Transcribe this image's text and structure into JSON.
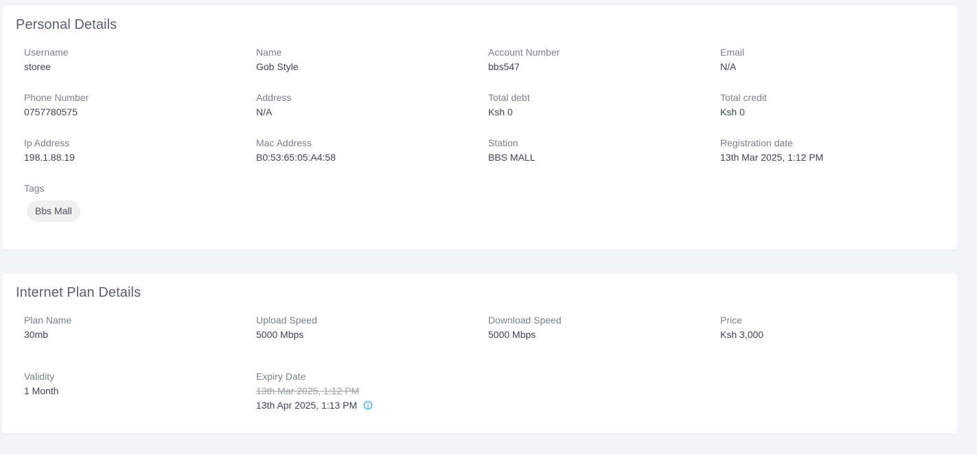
{
  "personal": {
    "title": "Personal Details",
    "fields": [
      {
        "label": "Username",
        "value": "storee"
      },
      {
        "label": "Name",
        "value": "Gob Style"
      },
      {
        "label": "Account Number",
        "value": "bbs547"
      },
      {
        "label": "Email",
        "value": "N/A"
      },
      {
        "label": "Phone Number",
        "value": "0757780575"
      },
      {
        "label": "Address",
        "value": "N/A"
      },
      {
        "label": "Total debt",
        "value": "Ksh 0"
      },
      {
        "label": "Total credit",
        "value": "Ksh 0"
      },
      {
        "label": "Ip Address",
        "value": "198.1.88.19"
      },
      {
        "label": "Mac Address",
        "value": "B0:53:65:05:A4:58"
      },
      {
        "label": "Station",
        "value": "BBS MALL"
      },
      {
        "label": "Registration date",
        "value": "13th Mar 2025, 1:12 PM"
      }
    ],
    "tags_label": "Tags",
    "tags": [
      "Bbs Mall"
    ]
  },
  "plan": {
    "title": "Internet Plan Details",
    "fields": [
      {
        "label": "Plan Name",
        "value": "30mb"
      },
      {
        "label": "Upload Speed",
        "value": "5000 Mbps"
      },
      {
        "label": "Download Speed",
        "value": "5000 Mbps"
      },
      {
        "label": "Price",
        "value": "Ksh 3,000"
      },
      {
        "label": "Validity",
        "value": "1 Month"
      }
    ],
    "expiry": {
      "label": "Expiry Date",
      "old_value": "13th Mar 2025, 1:12 PM",
      "new_value": "13th Apr 2025, 1:13 PM",
      "icon": "info-icon",
      "icon_color": "#2a9fd8"
    }
  }
}
